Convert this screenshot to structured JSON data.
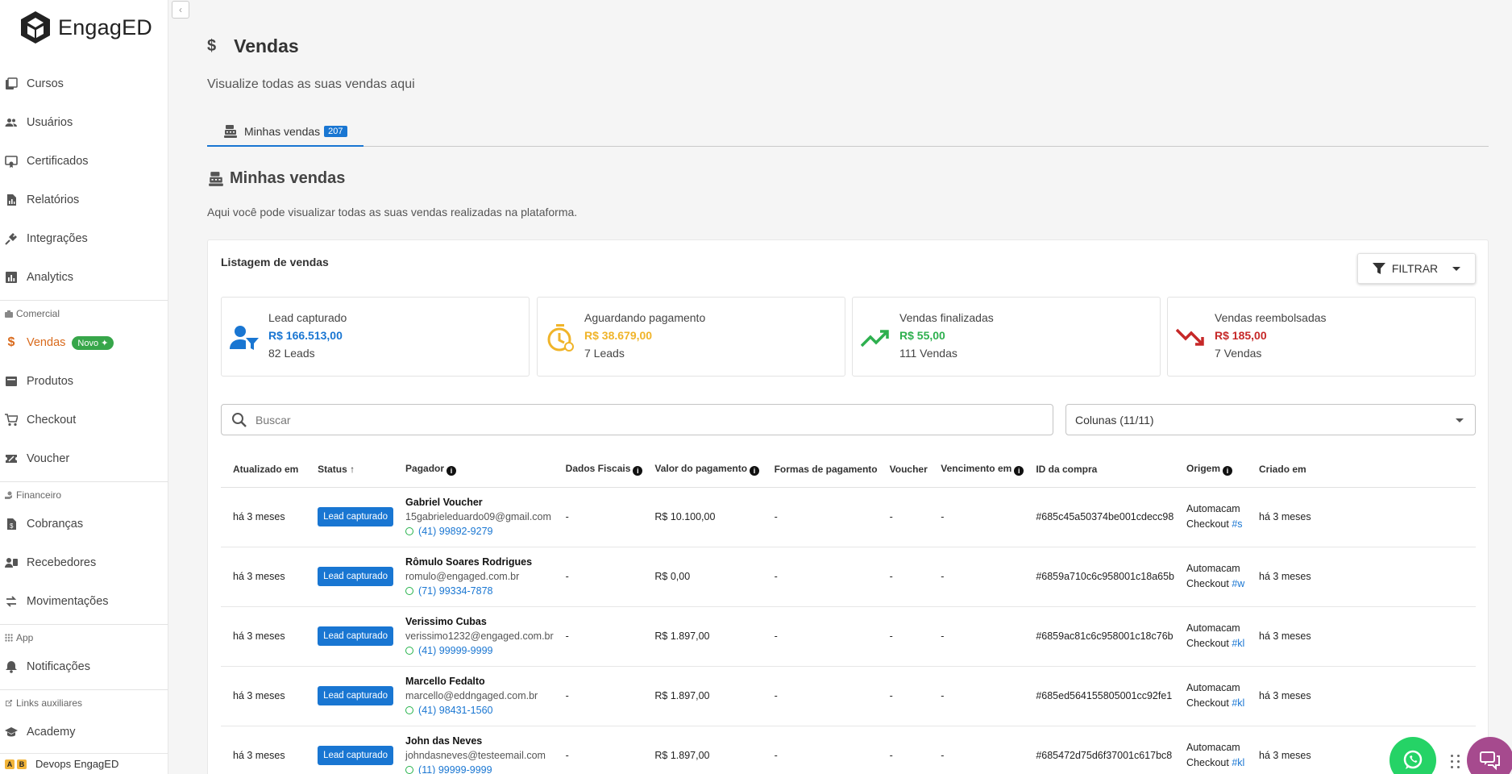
{
  "app": {
    "logo_text": "EngagED"
  },
  "sidebar": {
    "items_top": [
      {
        "label": "Cursos",
        "icon": "library-icon"
      },
      {
        "label": "Usuários",
        "icon": "users-icon"
      },
      {
        "label": "Certificados",
        "icon": "certificate-icon"
      },
      {
        "label": "Relatórios",
        "icon": "report-icon"
      },
      {
        "label": "Integrações",
        "icon": "plug-icon"
      },
      {
        "label": "Analytics",
        "icon": "bar-chart-icon"
      }
    ],
    "section_comercial": "Comercial",
    "vendas": {
      "label": "Vendas",
      "badge": "Novo ✦"
    },
    "items_comercial": [
      {
        "label": "Produtos"
      },
      {
        "label": "Checkout"
      },
      {
        "label": "Voucher"
      }
    ],
    "section_financeiro": "Financeiro",
    "items_financeiro": [
      {
        "label": "Cobranças"
      },
      {
        "label": "Recebedores"
      },
      {
        "label": "Movimentações"
      }
    ],
    "section_app": "App",
    "notificacoes": "Notificações",
    "section_links": "Links auxiliares",
    "academy": "Academy",
    "footer": {
      "key_a": "A",
      "key_b": "B",
      "text": "Devops EngagED"
    }
  },
  "header": {
    "title": "Vendas",
    "subtitle": "Visualize todas as suas vendas aqui"
  },
  "tabs": [
    {
      "label": "Minhas vendas",
      "count": "207"
    }
  ],
  "section": {
    "title": "Minhas vendas",
    "description": "Aqui você pode visualizar todas as suas vendas realizadas na plataforma."
  },
  "card": {
    "title": "Listagem de vendas",
    "filter_label": "FILTRAR",
    "search_placeholder": "Buscar",
    "columns_label": "Colunas (11/11)"
  },
  "stats": [
    {
      "label": "Lead capturado",
      "value": "R$ 166.513,00",
      "count": "82 Leads",
      "color": "#1976d2"
    },
    {
      "label": "Aguardando pagamento",
      "value": "R$ 38.679,00",
      "count": "7 Leads",
      "color": "#f0b429"
    },
    {
      "label": "Vendas finalizadas",
      "value": "R$ 55,00",
      "count": "111 Vendas",
      "color": "#2eb04f"
    },
    {
      "label": "Vendas reembolsadas",
      "value": "R$ 185,00",
      "count": "7 Vendas",
      "color": "#c62828"
    }
  ],
  "table": {
    "headers": [
      "Atualizado em",
      "Status",
      "Pagador",
      "Dados Fiscais",
      "Valor do pagamento",
      "Formas de pagamento",
      "Voucher",
      "Vencimento em",
      "ID da compra",
      "Origem",
      "Criado em"
    ],
    "rows": [
      {
        "updated": "há 3 meses",
        "status": "Lead capturado",
        "name": "Gabriel Voucher",
        "email": "15gabrieleduardo09@gmail.com",
        "phone": "(41) 99892-9279",
        "fiscal": "-",
        "value": "R$ 10.100,00",
        "payment": "-",
        "voucher": "-",
        "due": "-",
        "id": "#685c45a50374be001cdecc98",
        "origem1": "Automacam",
        "origem2": "Checkout",
        "origem_link": "#s",
        "created": "há 3 meses"
      },
      {
        "updated": "há 3 meses",
        "status": "Lead capturado",
        "name": "Rômulo Soares Rodrigues",
        "email": "romulo@engaged.com.br",
        "phone": "(71) 99334-7878",
        "fiscal": "-",
        "value": "R$ 0,00",
        "payment": "-",
        "voucher": "-",
        "due": "-",
        "id": "#6859a710c6c958001c18a65b",
        "origem1": "Automacam",
        "origem2": "Checkout",
        "origem_link": "#w",
        "created": "há 3 meses"
      },
      {
        "updated": "há 3 meses",
        "status": "Lead capturado",
        "name": "Verissimo Cubas",
        "email": "verissimo1232@engaged.com.br",
        "phone": "(41) 99999-9999",
        "fiscal": "-",
        "value": "R$ 1.897,00",
        "payment": "-",
        "voucher": "-",
        "due": "-",
        "id": "#6859ac81c6c958001c18c76b",
        "origem1": "Automacam",
        "origem2": "Checkout",
        "origem_link": "#kl",
        "created": "há 3 meses"
      },
      {
        "updated": "há 3 meses",
        "status": "Lead capturado",
        "name": "Marcello Fedalto",
        "email": "marcello@eddngaged.com.br",
        "phone": "(41) 98431-1560",
        "fiscal": "-",
        "value": "R$ 1.897,00",
        "payment": "-",
        "voucher": "-",
        "due": "-",
        "id": "#685ed564155805001cc92fe1",
        "origem1": "Automacam",
        "origem2": "Checkout",
        "origem_link": "#kl",
        "created": "há 3 meses"
      },
      {
        "updated": "há 3 meses",
        "status": "Lead capturado",
        "name": "John das Neves",
        "email": "johndasneves@testeemail.com",
        "phone": "(11) 99999-9999",
        "fiscal": "-",
        "value": "R$ 1.897,00",
        "payment": "-",
        "voucher": "-",
        "due": "-",
        "id": "#685472d75d6f37001c617bc8",
        "origem1": "Automacam",
        "origem2": "Checkout",
        "origem_link": "#kl",
        "created": "há 3 meses"
      }
    ]
  }
}
